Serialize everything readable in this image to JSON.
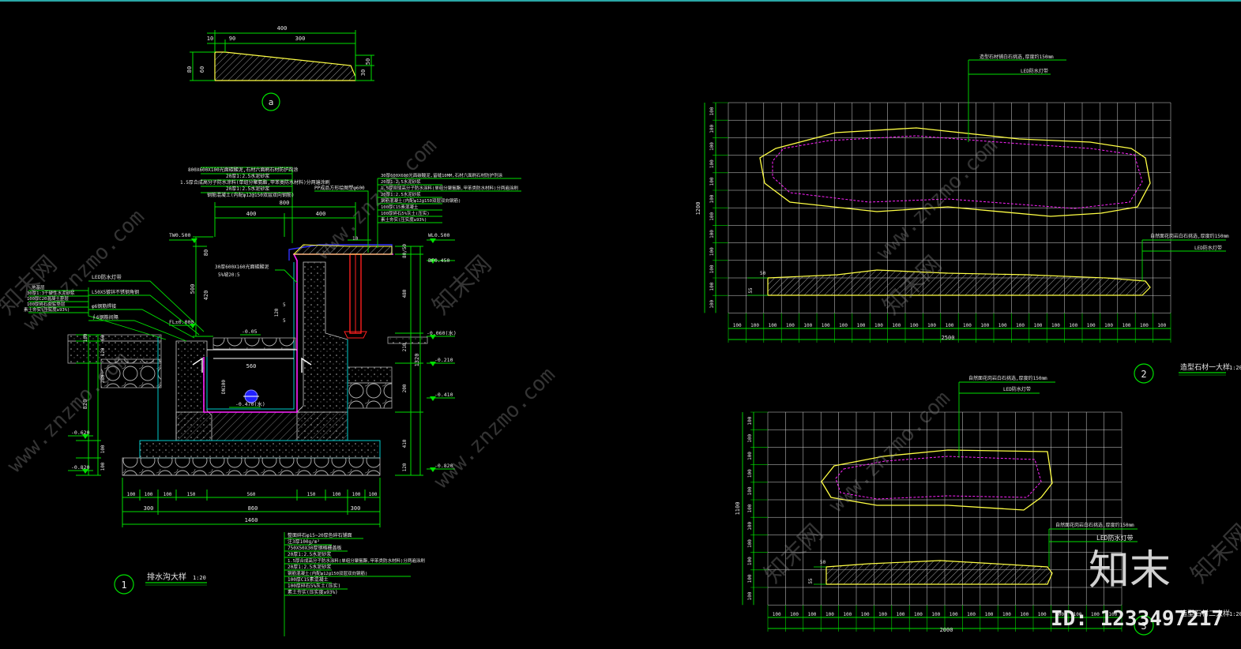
{
  "colors": {
    "background": "#000000",
    "dim_green": "#00e000",
    "grid_white": "#d8d8d8",
    "yellow": "#ffff44",
    "magenta": "#ff22ff",
    "cyan": "#00cccc",
    "blue": "#3030ff",
    "red": "#ff2020",
    "watermark": "#8a8a8a"
  },
  "detail_a": {
    "marker": "a",
    "dims_top": [
      "10",
      "90",
      "300"
    ],
    "dim_total": "400",
    "dims_left": [
      "80",
      "60"
    ],
    "dims_right": [
      "30",
      "50"
    ]
  },
  "detail_1": {
    "marker": "1",
    "title": "排水沟大样",
    "scale": "1:20",
    "top_notes": [
      "800X600X100光面碳酸泥,石材六面刷石材防护剂涂",
      "20厚1:2.5水泥砂浆",
      "1.5厚合成高分子防水涂料(单组分聚氨酯,甲苯类防水材料)分两遍涂刷",
      "20厚1:2.5水泥砂浆",
      "钢筋混凝土(内配φ12@150双层双向钢筋)"
    ],
    "right_notes": [
      "30厚600X600光面碳酸泥,留缝10MM,石材六面刷石材防护剂涂",
      "20厚1:2.5水泥砂浆",
      "1.5厚合成高分子防水涂料(单组分聚氨酯,甲苯类防水材料)分两遍涂刷",
      "20厚1:2.5水泥砂浆",
      "钢筋混凝土(内配φ12@150双层双向钢筋)",
      "100厚C15素混凝土",
      "100厚碎石5%灰土(压实)",
      "素土夯实(压实度≥93%)"
    ],
    "pp_note": "PP成品方形绘图塑φ600",
    "left_notes": [
      "LED防水灯带",
      "L50X5镀锌不锈钢角钢",
      "φ6钢筋焊接",
      "∮6钢筋间隔",
      "地基层",
      "30厚1:3干硬性水泥砂浆",
      "100厚C20混凝土垫层",
      "100厚碎石夯实垫层",
      "素土夯实(压实度≥93%)"
    ],
    "mid_notes": [
      "30厚600X160光面碳酸泥",
      "5%坡20:5"
    ],
    "levels": {
      "tw": "TW0.500",
      "wl": "WL0.500",
      "bf": "BF0.450",
      "fl": "FL±0.000",
      "m005": "-0.05",
      "m060": "-0.060(水)",
      "m210": "-0.210",
      "m410": "-0.410",
      "m470": "-0.470(水)",
      "m620": "-0.620",
      "m820a": "-0.820",
      "m820b": "-0.820"
    },
    "dims_top": [
      "800",
      "400",
      "400"
    ],
    "dim_inner": "560",
    "dim_pipe": "DN100",
    "dims_right": [
      "80/50",
      "480",
      "210",
      "1320",
      "200",
      "410",
      "120"
    ],
    "dims_left": [
      "80",
      "500",
      "420",
      "100",
      "60",
      "120",
      "280",
      "820",
      "100",
      "100"
    ],
    "dims_bottom_row1": [
      "100",
      "100",
      "100",
      "150",
      "560",
      "150",
      "100",
      "100",
      "100"
    ],
    "dims_bottom_row2": [
      "300",
      "860",
      "300"
    ],
    "dim_bottom_total": "1460",
    "bottom_notes": [
      "整面碎石φ15~20厚色碎石铺面",
      "注3厚100g/m²",
      "750X50X30厚钢格栅盖板",
      "20厚1:2.5水泥砂浆",
      "1.5厚合成高分子防水涂料(单组分聚氨酯,甲苯类防水材料)分两遍涂刷",
      "20厚1:2.5水泥砂浆",
      "钢筋混凝土(内配φ12@150双层双向钢筋)",
      "100厚C15素混凝土",
      "100厚碎石5%灰土(压实)",
      "素土夯实(压实度≥93%)"
    ],
    "small_dims": [
      "10",
      "5",
      "120",
      "5"
    ]
  },
  "detail_2": {
    "marker": "2",
    "title": "造型石材一大样",
    "scale": "1:20",
    "note_top1": "造型石材铺白石挑选,厚度约150mm",
    "note_top2": "LED防水灯带",
    "note_side1": "自然面花岗岩白石挑选,厚度约150mm",
    "note_side2": "LED防水灯带",
    "dims_left": [
      "100",
      "100",
      "100",
      "100",
      "100",
      "100",
      "100",
      "100",
      "100",
      "100",
      "100",
      "100"
    ],
    "dim_left_total": "1200",
    "dims_bottom": [
      "100",
      "100",
      "100",
      "100",
      "100",
      "100",
      "100",
      "100",
      "100",
      "100",
      "100",
      "100",
      "100",
      "100",
      "100",
      "100",
      "100",
      "100",
      "100",
      "100",
      "100",
      "100",
      "100",
      "100",
      "100"
    ],
    "dim_bottom_total": "2500",
    "small_dims": [
      "50",
      "55"
    ]
  },
  "detail_3": {
    "marker": "3",
    "title": "造型石材二大样",
    "scale": "1:20",
    "note_top1": "自然面花岗岩白石挑选,厚度约150mm",
    "note_top2": "LED防水灯带",
    "note_side1": "自然面花岗岩白石挑选,厚度约150mm",
    "note_side2": "LED防水灯带",
    "dims_left": [
      "100",
      "100",
      "100",
      "100",
      "100",
      "100",
      "100",
      "100",
      "100",
      "100",
      "100"
    ],
    "dim_left_total": "1100",
    "dims_bottom": [
      "100",
      "100",
      "100",
      "100",
      "100",
      "100",
      "100",
      "100",
      "100",
      "100",
      "100",
      "100",
      "100",
      "100",
      "100",
      "100",
      "100",
      "100",
      "100",
      "100"
    ],
    "dim_bottom_total": "2000",
    "small_dims": [
      "50",
      "55"
    ]
  },
  "watermarks": {
    "site": "www.znzmo.com",
    "brand_cn": "知末网",
    "logo": "知末",
    "id_label": "ID: 1233497217"
  }
}
